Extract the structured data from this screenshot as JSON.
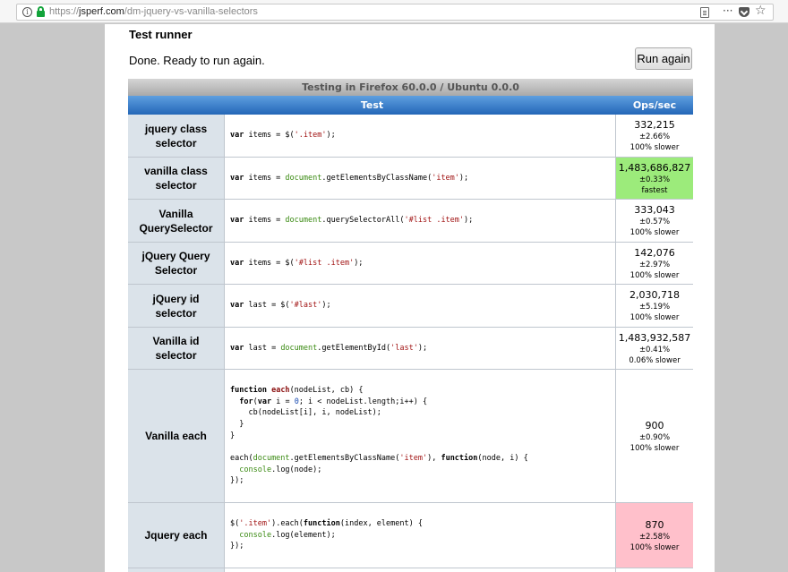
{
  "browser": {
    "url_prefix": "https://",
    "url_domain": "jsperf.com",
    "url_path": "/dm-jquery-vs-vanilla-selectors",
    "more_label": "···",
    "star_label": "☆",
    "info_label": "i"
  },
  "runner": {
    "title": "Test runner",
    "status": "Done. Ready to run again.",
    "run_button": "Run again"
  },
  "table": {
    "caption": "Testing in Firefox 60.0.0 / Ubuntu 0.0.0",
    "col_test": "Test",
    "col_ops": "Ops/sec",
    "rows": [
      {
        "name": "jquery class selector",
        "ops": "332,215",
        "err": "±2.66%",
        "rel": "100% slower",
        "status": "normal"
      },
      {
        "name": "vanilla class selector",
        "ops": "1,483,686,827",
        "err": "±0.33%",
        "rel": "fastest",
        "status": "fastest"
      },
      {
        "name": "Vanilla QuerySelector",
        "ops": "333,043",
        "err": "±0.57%",
        "rel": "100% slower",
        "status": "normal"
      },
      {
        "name": "jQuery Query Selector",
        "ops": "142,076",
        "err": "±2.97%",
        "rel": "100% slower",
        "status": "normal"
      },
      {
        "name": "jQuery id selector",
        "ops": "2,030,718",
        "err": "±5.19%",
        "rel": "100% slower",
        "status": "normal"
      },
      {
        "name": "Vanilla id selector",
        "ops": "1,483,932,587",
        "err": "±0.41%",
        "rel": "0.06% slower",
        "status": "normal"
      },
      {
        "name": "Vanilla each",
        "ops": "900",
        "err": "±0.90%",
        "rel": "100% slower",
        "status": "normal"
      },
      {
        "name": "Jquery each",
        "ops": "870",
        "err": "±2.58%",
        "rel": "100% slower",
        "status": "slowest"
      }
    ]
  },
  "colors": {
    "fastest": "#9ceb7b",
    "slowest": "#ffc0cb",
    "header_blue": "#2467b7"
  }
}
